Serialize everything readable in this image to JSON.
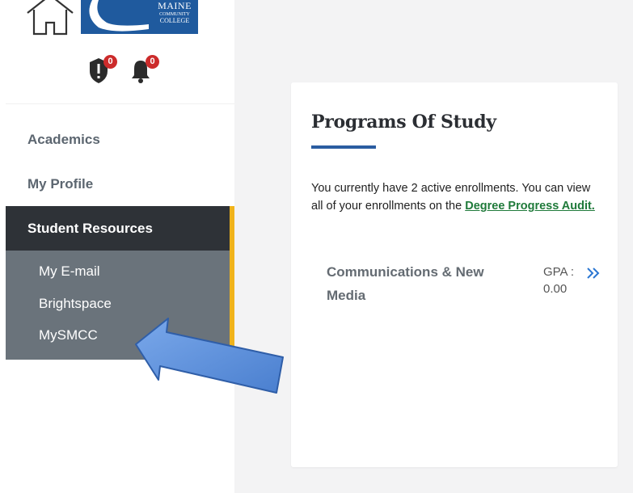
{
  "sidebar": {
    "logo": {
      "line1": "MAINE",
      "line2": "COMMUNITY",
      "line3": "COLLEGE"
    },
    "alerts": {
      "alert_count": "0",
      "notification_count": "0"
    },
    "nav": {
      "academics": "Academics",
      "my_profile": "My Profile",
      "student_resources": "Student Resources"
    },
    "submenu": {
      "email": "My E-mail",
      "brightspace": "Brightspace",
      "mysmcc": "MySMCC"
    },
    "accent_color": "#f0b31b"
  },
  "card": {
    "title": "Programs Of Study",
    "intro": "You currently have 2 active enrollments. You can view all of your enrollments on the",
    "link_text": "Degree Progress Audit.",
    "program": {
      "name": "Communications & New Media",
      "gpa_label": "GPA :",
      "gpa_value": "0.00"
    }
  },
  "annotation": {
    "arrow_color": "#5b8fd9"
  }
}
